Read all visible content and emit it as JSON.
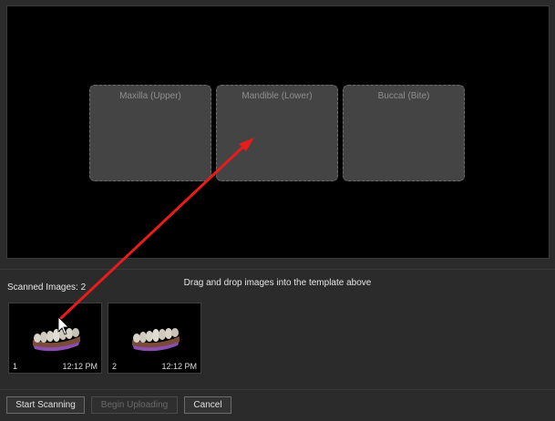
{
  "template": {
    "slots": [
      {
        "label": "Maxilla (Upper)"
      },
      {
        "label": "Mandible (Lower)"
      },
      {
        "label": "Buccal (Bite)"
      }
    ]
  },
  "instructions": "Drag and drop images into the template above",
  "scanned": {
    "label": "Scanned Images: 2",
    "images": [
      {
        "index": "1",
        "time": "12:12 PM"
      },
      {
        "index": "2",
        "time": "12:12 PM"
      }
    ]
  },
  "buttons": {
    "start": "Start Scanning",
    "upload": "Begin Uploading",
    "cancel": "Cancel"
  },
  "colors": {
    "arrow": "#e81c1c",
    "teeth": "#d8d4c8",
    "gum": "#7a4a3a",
    "tray": "#8a4fb0"
  }
}
